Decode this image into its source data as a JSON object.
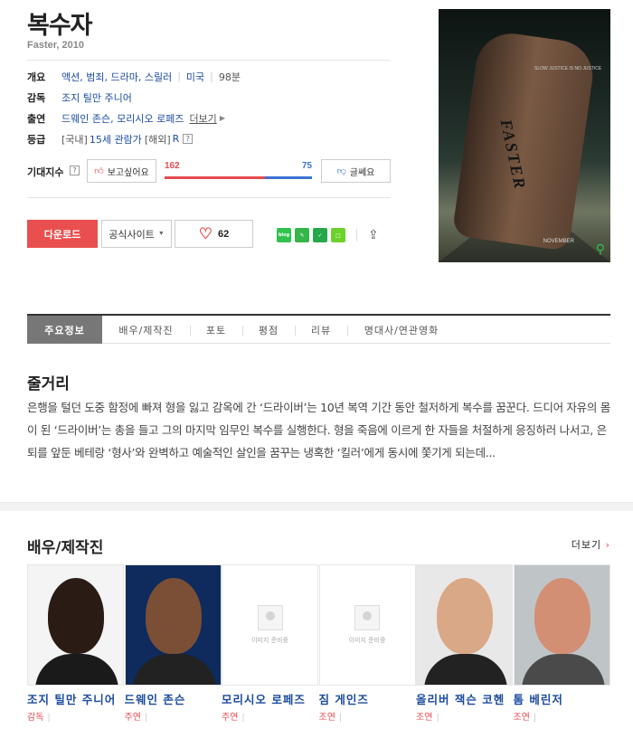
{
  "movie": {
    "title": "복수자",
    "subtitle": "Faster, 2010"
  },
  "info": {
    "overview_label": "개요",
    "genres": "액션, 범죄, 드라마, 스릴러",
    "country": "미국",
    "runtime": "98분",
    "director_label": "감독",
    "director": "조지 틸만 주니어",
    "cast_label": "출연",
    "cast": "드웨인 존슨, 모리시오 로페즈",
    "more": "더보기",
    "rating_label": "등급",
    "rating_kr_prefix": "[국내]",
    "rating_kr": "15세 관람가",
    "rating_intl_prefix": "[해외]",
    "rating_intl": "R",
    "help": "?"
  },
  "expectation": {
    "label": "기대지수",
    "want_button": "보고싶어요",
    "meh_button": "글쎄요",
    "want_count": "162",
    "meh_count": "75",
    "want_ratio": 0.684
  },
  "actions": {
    "download": "다운로드",
    "official_site": "공식사이트",
    "likes": "62",
    "blog_icon": "blog"
  },
  "tabs": [
    "주요정보",
    "배우/제작진",
    "포토",
    "평점",
    "리뷰",
    "명대사/연관영화"
  ],
  "plot": {
    "heading": "줄거리",
    "text": "은행을 털던 도중 함정에 빠져 형을 잃고 감옥에 간 ‘드라이버’는 10년 복역 기간 동안 철저하게 복수를 꿈꾼다. 드디어 자유의 몸이 된 ‘드라이버’는 총을 들고 그의 마지막 임무인 복수를 실행한다. 형을 죽음에 이르게 한 자들을 처절하게 응징하러 나서고, 은퇴를 앞둔 베테랑 ‘형사’와 완벽하고 예술적인 살인을 꿈꾸는 냉혹한 ‘킬러’에게 동시에 쫓기게 되는데..."
  },
  "poster": {
    "tagline": "SLOW JUSTICE IS NO JUSTICE",
    "brand": "FASTER",
    "month": "NOVEMBER"
  },
  "cast_section": {
    "heading": "배우/제작진",
    "more": "더보기",
    "placeholder": "이미지 준비중",
    "people": [
      {
        "name": "조지 틸만 주니어",
        "role": "감독",
        "photo": "face"
      },
      {
        "name": "드웨인 존슨",
        "role": "주연",
        "photo": "face"
      },
      {
        "name": "모리시오 로페즈",
        "role": "주연",
        "photo": "none"
      },
      {
        "name": "짐 게인즈",
        "role": "조연",
        "photo": "none"
      },
      {
        "name": "올리버 잭슨 코헨",
        "role": "조연",
        "photo": "face"
      },
      {
        "name": "톰 베린저",
        "role": "조연",
        "photo": "face"
      }
    ]
  },
  "colors": {
    "accent_red": "#ea4f4f",
    "link_blue": "#1b4ba0",
    "meh_blue": "#3b73d3"
  }
}
